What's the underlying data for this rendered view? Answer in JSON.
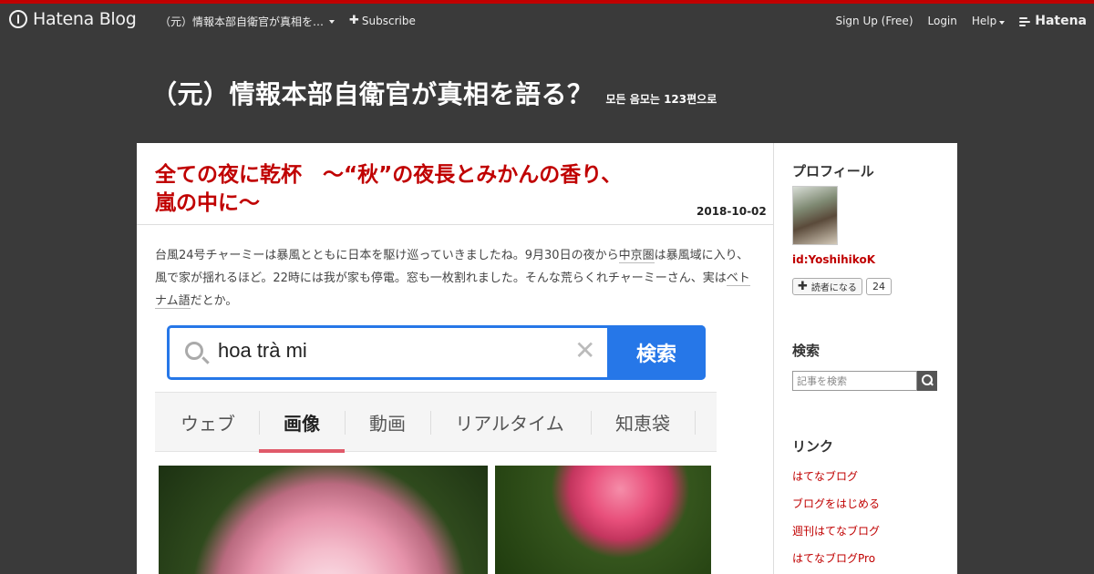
{
  "global_header": {
    "logo_text": "Hatena Blog",
    "blog_name": "（元）情報本部自衛官が真相を…",
    "subscribe_label": "Subscribe",
    "signup_label": "Sign Up (Free)",
    "login_label": "Login",
    "help_label": "Help",
    "hatena_label": "Hatena"
  },
  "blog": {
    "title": "（元）情報本部自衛官が真相を語る？",
    "description": "모든 음모는 123편으로"
  },
  "entry": {
    "title_line1": "全ての夜に乾杯　〜“秋”の夜長とみかんの香り、",
    "title_line2": "嵐の中に〜",
    "date": "2018-10-02",
    "body_1": "台風24号チャーミーは暴風とともに日本を駆け巡っていきましたね。9月30日の夜から",
    "body_kw1": "中京圏",
    "body_2": "は暴風域に入り、風で家が揺れるほど。22時には我が家も停電。窓も一枚割れました。そんな荒らくれチャーミーさん、実は",
    "body_kw2": "ベトナム語",
    "body_3": "だとか。"
  },
  "screenshot": {
    "query": "hoa trà mi",
    "search_button": "検索",
    "tabs": [
      "ウェブ",
      "画像",
      "動画",
      "リアルタイム",
      "知恵袋"
    ],
    "active_tab": "画像"
  },
  "sidebar": {
    "profile_heading": "プロフィール",
    "user_id": "id:YoshihikoK",
    "reader_button": "読者になる",
    "reader_count": "24",
    "search_heading": "検索",
    "search_placeholder": "記事を検索",
    "links_heading": "リンク",
    "links": [
      "はてなブログ",
      "ブログをはじめる",
      "週刊はてなブログ",
      "はてなブログPro"
    ]
  },
  "colors": {
    "accent": "#c00000",
    "header_bg": "#3a3a3a",
    "search_blue": "#2677e8",
    "tab_underline": "#e05a6a"
  },
  "icons": {
    "logo": "hatena-blog-logo-icon",
    "search": "search-icon",
    "clear": "close-icon",
    "plus": "plus-icon",
    "caret": "chevron-down-icon"
  }
}
